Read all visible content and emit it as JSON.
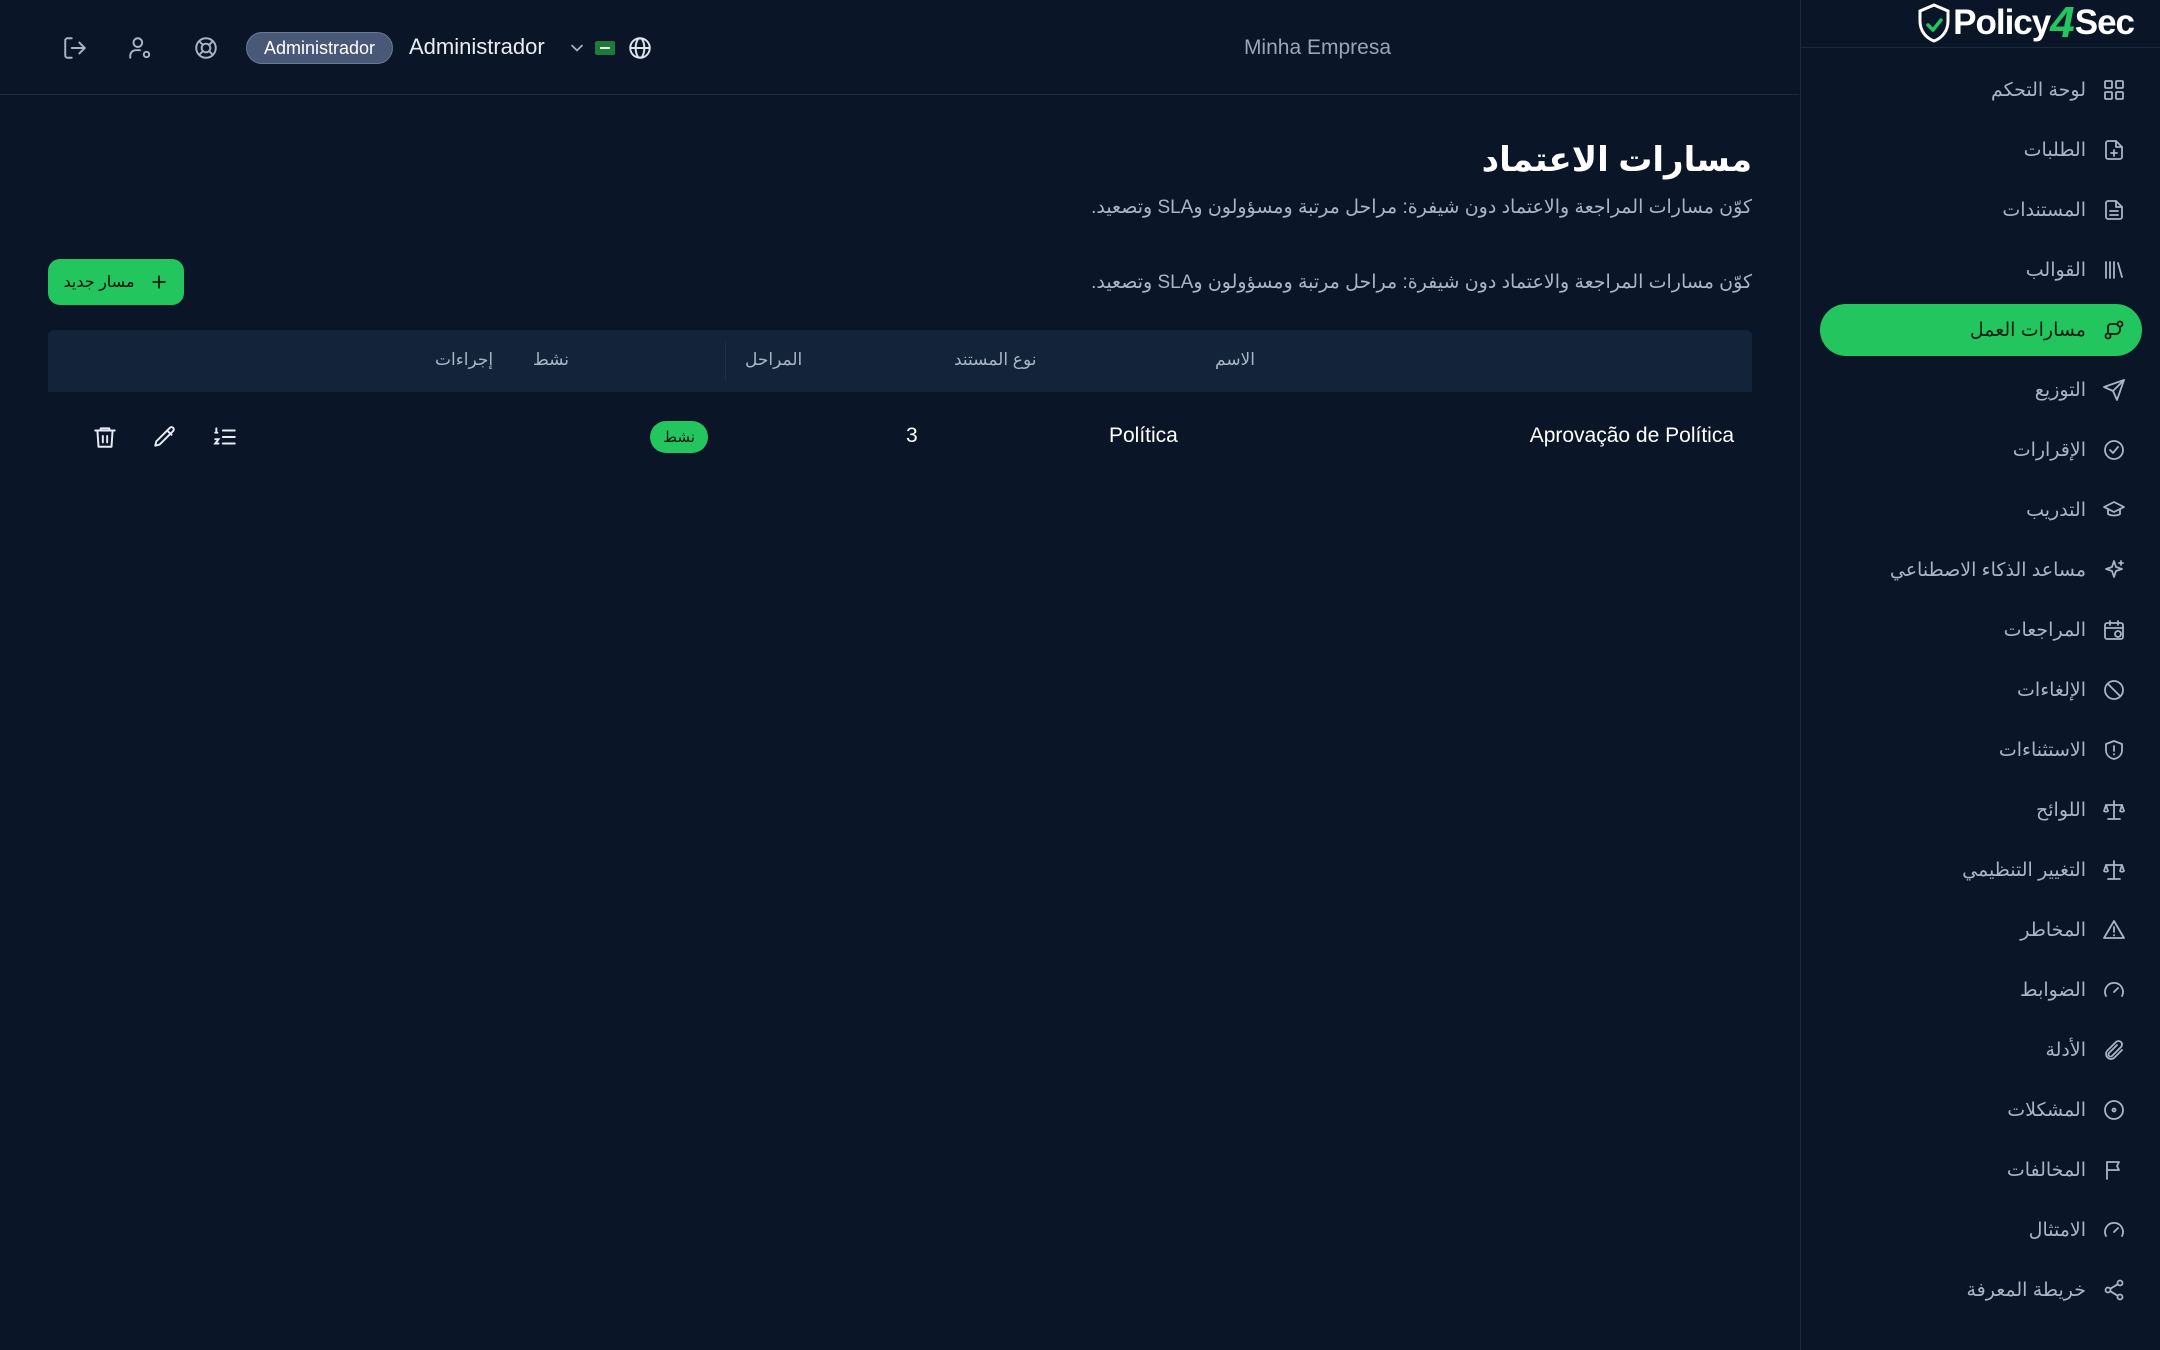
{
  "app": {
    "logo_text_before": "Policy",
    "logo_text_digit": "4",
    "logo_text_after": "Sec"
  },
  "topbar": {
    "role_badge": "Administrador",
    "user_name": "Administrador",
    "company": "Minha Empresa"
  },
  "sidebar": {
    "items": [
      {
        "label": "لوحة التحكم",
        "icon": "dashboard-icon"
      },
      {
        "label": "الطلبات",
        "icon": "file-plus-icon"
      },
      {
        "label": "المستندات",
        "icon": "document-icon"
      },
      {
        "label": "القوالب",
        "icon": "library-icon"
      },
      {
        "label": "مسارات العمل",
        "icon": "workflow-icon",
        "active": true
      },
      {
        "label": "التوزيع",
        "icon": "send-icon"
      },
      {
        "label": "الإقرارات",
        "icon": "check-circle-icon"
      },
      {
        "label": "التدريب",
        "icon": "graduation-cap-icon"
      },
      {
        "label": "مساعد الذكاء الاصطناعي",
        "icon": "sparkles-icon"
      },
      {
        "label": "المراجعات",
        "icon": "calendar-clock-icon"
      },
      {
        "label": "الإلغاءات",
        "icon": "ban-icon"
      },
      {
        "label": "الاستثناءات",
        "icon": "shield-alert-icon"
      },
      {
        "label": "اللوائح",
        "icon": "scale-icon"
      },
      {
        "label": "التغيير التنظيمي",
        "icon": "scale-icon"
      },
      {
        "label": "المخاطر",
        "icon": "warning-triangle-icon"
      },
      {
        "label": "الضوابط",
        "icon": "gauge-icon"
      },
      {
        "label": "الأدلة",
        "icon": "paperclip-icon"
      },
      {
        "label": "المشكلات",
        "icon": "circle-dot-icon"
      },
      {
        "label": "المخالفات",
        "icon": "flag-icon"
      },
      {
        "label": "الامتثال",
        "icon": "gauge-icon"
      },
      {
        "label": "خريطة المعرفة",
        "icon": "share-icon"
      }
    ]
  },
  "page": {
    "title": "مسارات الاعتماد",
    "subtitle": "كوّن مسارات المراجعة والاعتماد دون شيفرة: مراحل مرتبة ومسؤولون وSLA وتصعيد.",
    "list_description": "كوّن مسارات المراجعة والاعتماد دون شيفرة: مراحل مرتبة ومسؤولون وSLA وتصعيد.",
    "new_button": "مسار جديد"
  },
  "table": {
    "headers": {
      "name": "الاسم",
      "doc_type": "نوع المستند",
      "stages": "المراحل",
      "active": "نشط",
      "actions": "إجراءات"
    },
    "rows": [
      {
        "name": "Aprovação de Política",
        "doc_type": "Política",
        "stages": "3",
        "status": "نشط"
      }
    ]
  },
  "colors": {
    "background": "#0a1628",
    "accent": "#22c55e",
    "table_header": "#12233a",
    "badge": "#4a5878"
  }
}
